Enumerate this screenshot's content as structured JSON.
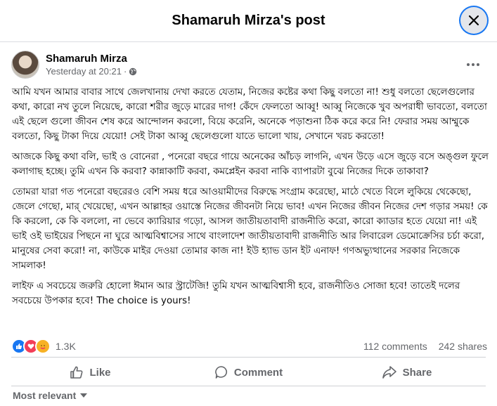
{
  "header": {
    "title": "Shamaruh Mirza's post"
  },
  "post": {
    "author": "Shamaruh Mirza",
    "timestamp": "Yesterday at 20:21",
    "separator": "·",
    "audience_icon": "globe-icon",
    "paragraphs": [
      "আমি যখন আমার বাবার সাথে জেলখানায় দেখা করতে যেতাম, নিজের কষ্টের কথা কিছু বলতো না! শুধু বলতো ছেলেগুলোর কথা, কারো নখ তুলে নিয়েছে, কারো শরীর জুড়ে মারের দাগ! কেঁদে ফেলতো আব্বু! আব্বু নিজেকে খুব অপরাধী ভাবতো, বলতো এই ছেলে গুলো জীবন শেষ করে আন্দোলন করলো, বিয়ে করেনি, অনেকে পড়াশুনা ঠিক করে করে নি!  ফেরার সময় আম্মুকে বলতো, কিছু টাকা দিয়ে যেয়ো! সেই টাকা আব্বু ছেলেগুলো যাতে ভালো খায়, সেখানে খরচ করতো!",
      "আজকে কিছু কথা বলি, ভাই ও বোনেরা , পনেরো বছরে গায়ে অনেকের আঁচড়  লাগনি, এখন উড়ে এসে জুড়ে বসে অঙ্গুল ফুলে কলাগাছ হচ্ছে। তুমি এখন কি করবা? কান্নাকাটি করবা, কমপ্লেইন করবা নাকি ব্যাপারটা বুঝে নিজের দিকে তাকাবা?",
      " তোমরা যারা গত পনেরো বছরেরও বেশি সময় ধরে আওয়ামীদের বিরুদ্ধে সংগ্রাম করেছো, মাঠে খেতে বিলে লুকিয়ে থেকেছো, জেলে গেছো, মার্ খেয়েছো, এখন আল্লাহর ওয়াস্তে নিজের জীবনটা নিয়ে ভাব! এখন নিজের জীবন নিজের দেশ গড়ার  সময়!  কে কি করলো, কে কি বললো, না ভেবে ক্যারিয়ার গড়ো, আসল জাতীয়তাবাদী  রাজনীতি করো, কারো ক্যাডার হতে যেয়ো না! এই ভাই ওই ভাইয়ের পিছনে না ঘুরে আত্মবিশ্বাসের  সাথে বাংলাদেশ জাতীয়তাবাদী রাজনীতি আর লিবারেল ডেমোক্রেসির চর্চা করো, মানুষের সেবা করো! না, কাউকে  মাইর দেওয়া তোমার কাজ না! ইউ হ্যাভ ডান ইট এনাফ!  গণঅভ্যুত্থানের সরকার নিজেকে সামলাক!",
      "লাইফ এ সবচেয়ে জরুরি হোলো ঈমান আর স্ট্রাটেজি! তুমি যখন আত্মবিশ্বাসী হবে, রাজনীতিও সোজা হবে! তাতেই দলের সবচেয়ে উপকার হবে! The choice is yours!"
    ]
  },
  "stats": {
    "reactions": "1.3K",
    "comments": "112 comments",
    "shares": "242 shares"
  },
  "actions": {
    "like": "Like",
    "comment": "Comment",
    "share": "Share"
  },
  "comments_sort": {
    "label": "Most relevant"
  },
  "colors": {
    "accent": "#1877f2",
    "love": "#f33e58",
    "care": "#f7b125",
    "secondary_text": "#65676b"
  }
}
